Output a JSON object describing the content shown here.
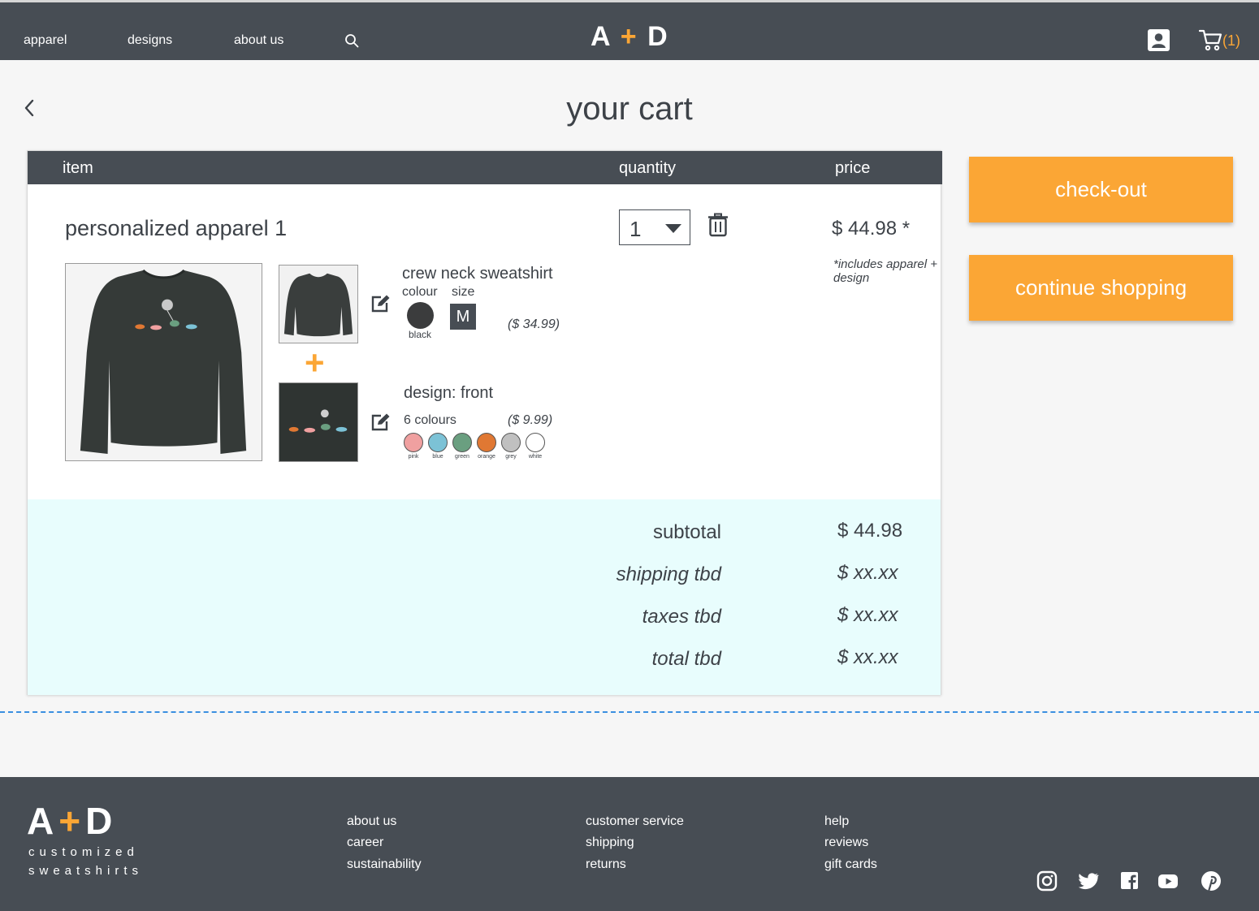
{
  "nav": {
    "links": [
      "apparel",
      "designs",
      "about us"
    ],
    "logo": {
      "left": "A",
      "plus": "+",
      "right": "D"
    },
    "cart_count": "(1)",
    "icons": [
      "search-icon",
      "account-icon",
      "cart-icon"
    ]
  },
  "page": {
    "title": "your cart"
  },
  "cart": {
    "headers": {
      "item": "item",
      "quantity": "quantity",
      "price": "price"
    },
    "item": {
      "name": "personalized apparel 1",
      "quantity": "1",
      "price": "$ 44.98 *",
      "price_note": "*includes apparel + design",
      "apparel": {
        "title": "crew neck sweatshirt",
        "colour_label": "colour",
        "size_label": "size",
        "colour": "black",
        "size": "M",
        "price": "($ 34.99)"
      },
      "combine": "+",
      "design": {
        "title": "design: front",
        "colours_count": "6 colours",
        "price": "($ 9.99)",
        "swatches": [
          {
            "name": "pink",
            "color": "#f0a0a0"
          },
          {
            "name": "blue",
            "color": "#7cc2d6"
          },
          {
            "name": "green",
            "color": "#6a9f80"
          },
          {
            "name": "orange",
            "color": "#e07833"
          },
          {
            "name": "grey",
            "color": "#c0c0c0"
          },
          {
            "name": "white",
            "color": "#ffffff"
          }
        ]
      }
    },
    "summary": {
      "subtotal_label": "subtotal",
      "subtotal_value": "$ 44.98",
      "shipping_label": "shipping tbd",
      "shipping_value": "$ xx.xx",
      "taxes_label": "taxes tbd",
      "taxes_value": "$ xx.xx",
      "total_label": "total tbd",
      "total_value": "$ xx.xx"
    }
  },
  "actions": {
    "checkout": "check-out",
    "continue": "continue shopping"
  },
  "footer": {
    "logo": {
      "left": "A",
      "plus": "+",
      "right": "D"
    },
    "tagline_1": "customized",
    "tagline_2": "sweatshirts",
    "col1": [
      "about us",
      "career",
      "sustainability"
    ],
    "col2": [
      "customer service",
      "shipping",
      "returns"
    ],
    "col3": [
      "help",
      "reviews",
      "gift cards"
    ],
    "social": [
      "instagram-icon",
      "twitter-icon",
      "facebook-icon",
      "youtube-icon",
      "pinterest-icon"
    ]
  },
  "colors": {
    "header": "#474d54",
    "accent": "#fba635",
    "summary_bg": "#e8fdfd",
    "page_bg": "#f6f6f6"
  }
}
